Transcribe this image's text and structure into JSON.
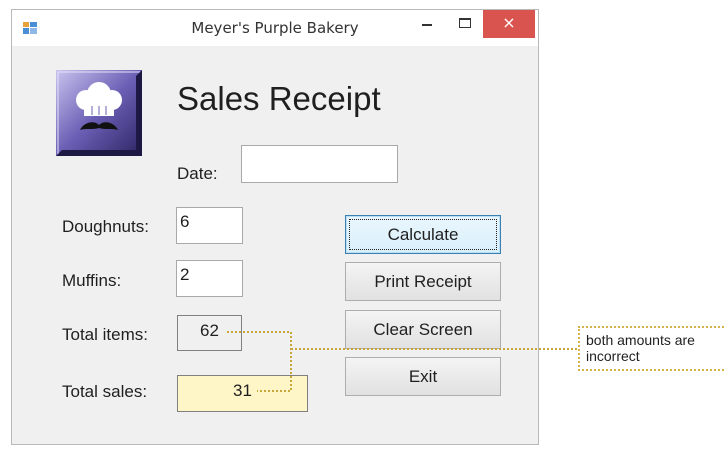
{
  "window": {
    "title": "Meyer's Purple Bakery",
    "close_glyph": "×"
  },
  "form": {
    "heading": "Sales Receipt",
    "date": {
      "label": "Date:",
      "value": ""
    },
    "doughnuts": {
      "label": "Doughnuts:",
      "value": "6"
    },
    "muffins": {
      "label": "Muffins:",
      "value": "2"
    },
    "total_items": {
      "label": "Total items:",
      "value": "62"
    },
    "total_sales": {
      "label": "Total sales:",
      "value": "31"
    }
  },
  "buttons": {
    "calculate": "Calculate",
    "print_receipt": "Print Receipt",
    "clear_screen": "Clear Screen",
    "exit": "Exit"
  },
  "annotation": {
    "text": "both amounts are incorrect"
  },
  "colors": {
    "accent_purple": "#6b5fb5",
    "close_red": "#d9534f",
    "highlight_yellow": "#fff6c8",
    "callout_border": "#d4b44a"
  },
  "icons": {
    "app": "app-window-icon",
    "logo": "chef-hat-mustache-logo"
  }
}
